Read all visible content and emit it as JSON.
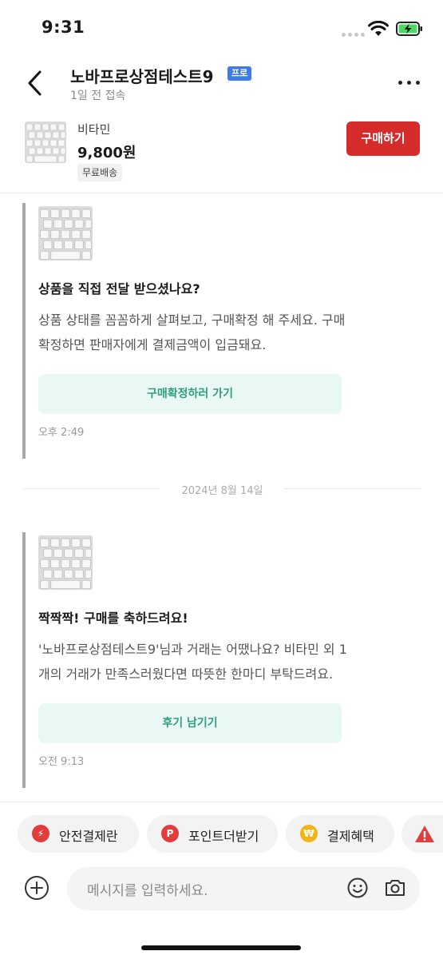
{
  "status_bar": {
    "time": "9:31"
  },
  "header": {
    "shop_name": "노바프로상점테스트9",
    "badge": "프로",
    "last_seen": "1일 전 접속"
  },
  "product": {
    "name": "비타민",
    "price": "9,800원",
    "shipping": "무료배송",
    "buy_label": "구매하기"
  },
  "messages": [
    {
      "title": "상품을 직접 전달 받으셨나요?",
      "body": "상품 상태를 꼼꼼하게 살펴보고, 구매확정 해 주세요. 구매확정하면 판매자에게 결제금액이 입금돼요.",
      "action": "구매확정하러 가기",
      "time": "오후 2:49"
    },
    {
      "title": "짝짝짝! 구매를 축하드려요!",
      "body": "'노바프로상점테스트9'님과 거래는 어땠나요? 비타민 외 1개의 거래가 만족스러웠다면 따뜻한 한마디 부탁드려요.",
      "action": "후기 남기기",
      "time": "오전 9:13"
    }
  ],
  "date_divider": "2024년 8월 14일",
  "chips": [
    {
      "label": "안전결제란",
      "icon": "lightning-icon",
      "glyph": "⚡",
      "color": "#e23d3d"
    },
    {
      "label": "포인트더받기",
      "icon": "point-p-icon",
      "glyph": "P",
      "color": "#e23d3d"
    },
    {
      "label": "결제혜택",
      "icon": "won-coin-icon",
      "glyph": "₩",
      "color": "#f2b416"
    },
    {
      "label": "",
      "icon": "warning-icon",
      "glyph": "!",
      "color": "#e23d3d"
    }
  ],
  "input": {
    "placeholder": "메시지를 입력하세요."
  },
  "colors": {
    "accent_red": "#d62b2b",
    "accent_green": "#2f9e7e",
    "action_bg": "#eaf8f5",
    "pro_badge": "#3d7be8"
  }
}
